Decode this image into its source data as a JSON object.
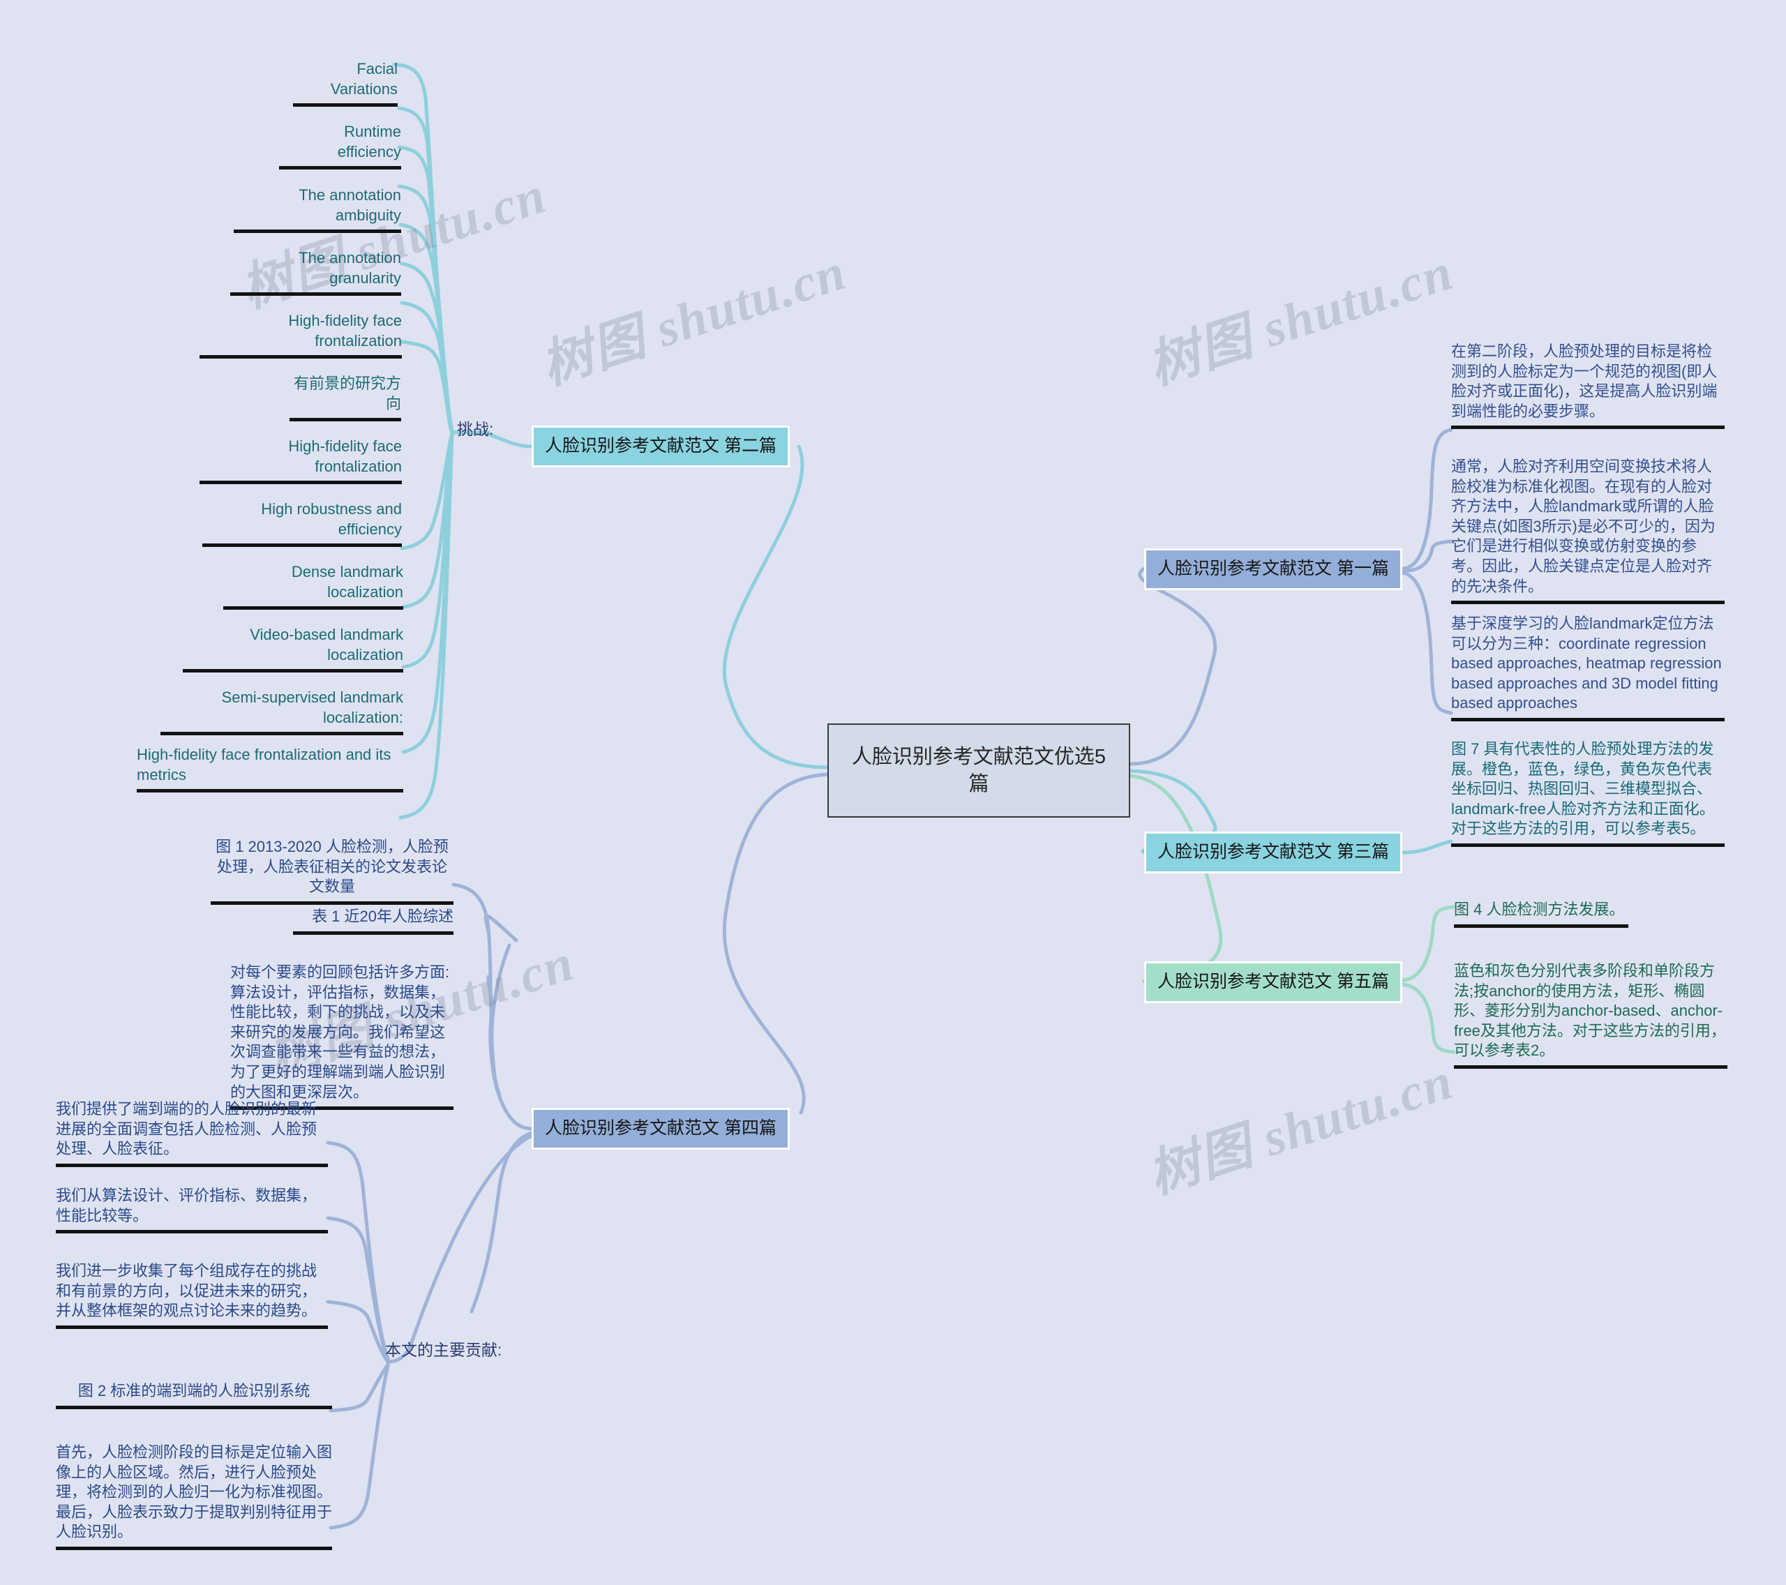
{
  "root": {
    "title": "人脸识别参考文献范文优选5篇"
  },
  "watermarks": [
    "树图 shutu.cn",
    "树图 shutu.cn",
    "树图 shutu.cn",
    "树图 shutu.cn",
    "树图 shutu.cn"
  ],
  "colors": {
    "background": "#dfe2f1",
    "root_fill": "#d3dae8",
    "cyan_branch": "#8ad3e0",
    "blue_branch": "#93aed8",
    "mint_branch": "#a3dec9",
    "leaf_teal_text": "#1c6b75",
    "leaf_navy_text": "#2b4a8a",
    "leaf_green_text": "#1d6b55",
    "link_cyan": "#8ecfdc",
    "link_blue": "#9fb3d8",
    "link_mint": "#9ed9c4",
    "underline": "#121212"
  },
  "branches": {
    "second": {
      "label": "人脸识别参考文献范文 第二篇",
      "group_label": "挑战:",
      "leaves": [
        "Facial Variations",
        "Runtime efficiency",
        "The annotation ambiguity",
        "The annotation granularity",
        "High-fidelity face frontalization",
        "有前景的研究方向",
        "High-fidelity face frontalization",
        "High robustness and efficiency",
        "Dense landmark localization",
        "Video-based landmark localization",
        "Semi-supervised landmark localization:",
        "High-fidelity face frontalization and its metrics"
      ]
    },
    "first": {
      "label": "人脸识别参考文献范文 第一篇",
      "leaves": [
        "在第二阶段，人脸预处理的目标是将检测到的人脸标定为一个规范的视图(即人脸对齐或正面化)，这是提高人脸识别端到端性能的必要步骤。",
        "通常，人脸对齐利用空间变换技术将人脸校准为标准化视图。在现有的人脸对齐方法中，人脸landmark或所谓的人脸关键点(如图3所示)是必不可少的，因为它们是进行相似变换或仿射变换的参考。因此，人脸关键点定位是人脸对齐的先决条件。",
        "基于深度学习的人脸landmark定位方法可以分为三种：coordinate regression based approaches, heatmap regression based approaches and 3D model fitting based approaches"
      ]
    },
    "third": {
      "label": "人脸识别参考文献范文 第三篇",
      "leaves": [
        "图 7 具有代表性的人脸预处理方法的发展。橙色，蓝色，绿色，黄色灰色代表坐标回归、热图回归、三维模型拟合、landmark-free人脸对齐方法和正面化。对于这些方法的引用，可以参考表5。"
      ]
    },
    "fifth": {
      "label": "人脸识别参考文献范文 第五篇",
      "leaves": [
        "图 4 人脸检测方法发展。",
        "蓝色和灰色分别代表多阶段和单阶段方法;按anchor的使用方法，矩形、椭圆形、菱形分别为anchor-based、anchor-free及其他方法。对于这些方法的引用，可以参考表2。"
      ]
    },
    "fourth": {
      "label": "人脸识别参考文献范文 第四篇",
      "group_label": "本文的主要贡献:",
      "leaves_top": [
        "图 1 2013-2020 人脸检测，人脸预处理，人脸表征相关的论文发表论文数量",
        "表 1 近20年人脸综述",
        "对每个要素的回顾包括许多方面: 算法设计，评估指标，数据集，性能比较，剩下的挑战，以及未来研究的发展方向。我们希望这次调查能带来一些有益的想法，为了更好的理解端到端人脸识别的大图和更深层次。"
      ],
      "leaves_contrib": [
        "我们提供了端到端的的人脸识别的最新进展的全面调查包括人脸检测、人脸预处理、人脸表征。",
        "我们从算法设计、评价指标、数据集，性能比较等。",
        "我们进一步收集了每个组成存在的挑战和有前景的方向，以促进未来的研究，并从整体框架的观点讨论未来的趋势。",
        "图 2 标准的端到端的人脸识别系统",
        "首先，人脸检测阶段的目标是定位输入图像上的人脸区域。然后，进行人脸预处理，将检测到的人脸归一化为标准视图。最后，人脸表示致力于提取判别特征用于人脸识别。"
      ]
    }
  }
}
